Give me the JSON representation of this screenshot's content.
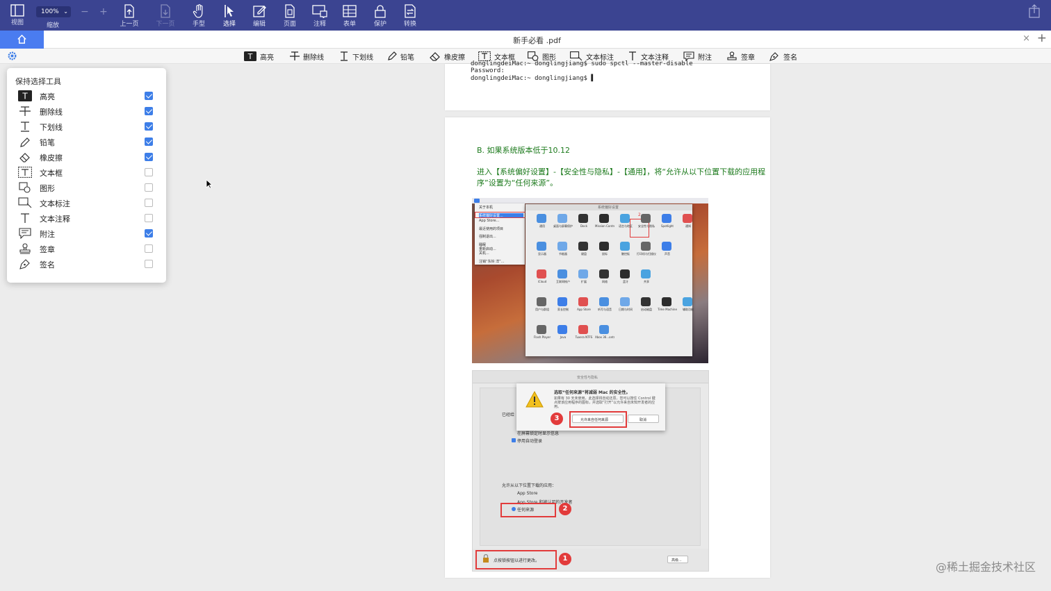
{
  "toolbar": {
    "view": "视图",
    "zoom_value": "100%",
    "zoom_label": "缩放",
    "prev_page": "上一页",
    "next_page": "下一页",
    "hand": "手型",
    "select": "选择",
    "edit": "编辑",
    "page": "页面",
    "annotate": "注释",
    "form": "表单",
    "protect": "保护",
    "convert": "转换"
  },
  "tabbar": {
    "document_title": "新手必看 .pdf"
  },
  "annotation_tools": [
    "高亮",
    "删除线",
    "下划线",
    "铅笔",
    "橡皮擦",
    "文本框",
    "图形",
    "文本标注",
    "文本注释",
    "附注",
    "签章",
    "签名"
  ],
  "popup": {
    "title": "保持选择工具",
    "items": [
      {
        "label": "高亮",
        "checked": true
      },
      {
        "label": "删除线",
        "checked": true
      },
      {
        "label": "下划线",
        "checked": true
      },
      {
        "label": "铅笔",
        "checked": true
      },
      {
        "label": "橡皮擦",
        "checked": true
      },
      {
        "label": "文本框",
        "checked": false
      },
      {
        "label": "图形",
        "checked": false
      },
      {
        "label": "文本标注",
        "checked": false
      },
      {
        "label": "文本注释",
        "checked": false
      },
      {
        "label": "附注",
        "checked": true
      },
      {
        "label": "签章",
        "checked": false
      },
      {
        "label": "签名",
        "checked": false
      }
    ]
  },
  "document": {
    "terminal_line1": "donglingdeiMac:~ donglingjiang$ sudo spctl --master-disable",
    "terminal_line2": "Password:",
    "terminal_line3": "donglingdeiMac:~ donglingjiang$ ▌",
    "heading": "B. 如果系统版本低于10.12",
    "instruction_line1": "进入【系统偏好设置】-【安全性与隐私】-【通用】，将“允许从以下位置下载的应用程",
    "instruction_line2": "序”设置为“任何来源”。",
    "screenshot1": {
      "menu_items": [
        "关于本机",
        "系统偏好设置...",
        "App Store...",
        "最近使用的项目",
        "强制退出...",
        "睡眠",
        "重新启动...",
        "关机...",
        "注销“东铃 洋”..."
      ],
      "window_title": "系统偏好设置",
      "pref_labels": [
        "通用",
        "桌面与屏幕保护程序",
        "Dock",
        "Mission Control",
        "语言与地区",
        "安全性与隐私",
        "Spotlight",
        "通知",
        "显示器",
        "节能器",
        "键盘",
        "鼠标",
        "触控板",
        "打印机与扫描仪",
        "声音",
        "iCloud",
        "互联网帐户",
        "扩展",
        "网络",
        "蓝牙",
        "共享",
        "用户与群组",
        "家长控制",
        "App Store",
        "听写与语音",
        "日期与时间",
        "启动磁盘",
        "Time Machine",
        "辅助功能",
        "Flash Player",
        "Java",
        "Tuxera NTFS",
        "Xbox 36...ontrollers"
      ],
      "marker": "2"
    },
    "screenshot2": {
      "window_title": "安全性与隐私",
      "dialog_title": "选取“任何来源”将减弱 Mac 的安全性。",
      "dialog_body": "如果有 30 天未使用，此选择将自动还原。您可以按住 Control 键点按该应用程序的图标，并选取“打开”以允许来自未知开发者的应用。",
      "allow_button": "允许来自任何来源",
      "cancel_button": "取消",
      "already_label": "已经给",
      "option_show_message": "在屏幕锁定时显示信息",
      "option_disable_autologin": "停用自动登录",
      "allow_apps_label": "允许从以下位置下载的应用：",
      "radio_app_store": "App Store",
      "radio_identified": "App Store 和被认可的开发者",
      "radio_anywhere": "任何来源",
      "lock_text": "点按锁按钮以进行更改。",
      "advanced_button": "高级...",
      "markers": [
        "1",
        "2",
        "3"
      ]
    }
  },
  "watermark": "@稀土掘金技术社区"
}
